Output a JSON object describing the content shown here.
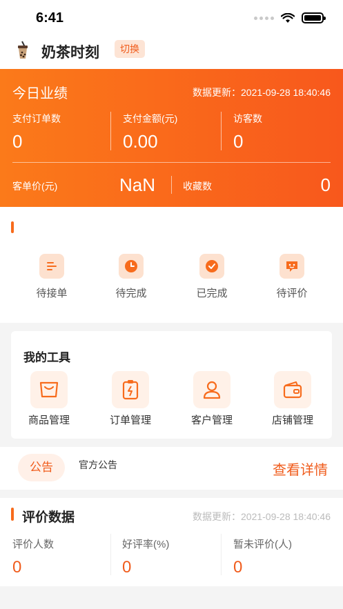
{
  "status_bar": {
    "time": "6:41"
  },
  "header": {
    "shop_name": "奶茶时刻",
    "switch_label": "切换"
  },
  "performance": {
    "title": "今日业绩",
    "update_label": "数据更新：",
    "update_time": "2021-09-28 18:40:46",
    "metrics": [
      {
        "label": "支付订单数",
        "value": "0"
      },
      {
        "label": "支付金额(元)",
        "value": "0.00"
      },
      {
        "label": "访客数",
        "value": "0"
      }
    ],
    "avg_price_label": "客单价(元)",
    "avg_price_value": "NaN",
    "favorites_label": "收藏数",
    "favorites_value": "0"
  },
  "orders": {
    "items": [
      {
        "label": "待接单",
        "icon": "list-icon"
      },
      {
        "label": "待完成",
        "icon": "clock-icon"
      },
      {
        "label": "已完成",
        "icon": "check-icon"
      },
      {
        "label": "待评价",
        "icon": "comment-icon"
      }
    ]
  },
  "tools": {
    "title": "我的工具",
    "items": [
      {
        "label": "商品管理",
        "icon": "bag-icon"
      },
      {
        "label": "订单管理",
        "icon": "clipboard-icon"
      },
      {
        "label": "客户管理",
        "icon": "user-icon"
      },
      {
        "label": "店铺管理",
        "icon": "wallet-icon"
      }
    ]
  },
  "notice": {
    "tag": "公告",
    "text": "官方公告",
    "more": "查看详情"
  },
  "review": {
    "title": "评价数据",
    "update_label": "数据更新：",
    "update_time": "2021-09-28 18:40:46",
    "metrics": [
      {
        "label": "评价人数",
        "value": "0"
      },
      {
        "label": "好评率(%)",
        "value": "0"
      },
      {
        "label": "暂未评价(人)",
        "value": "0"
      }
    ]
  },
  "colors": {
    "accent": "#f76b1c",
    "banner_start": "#fb7a1a",
    "banner_end": "#f8581c"
  }
}
